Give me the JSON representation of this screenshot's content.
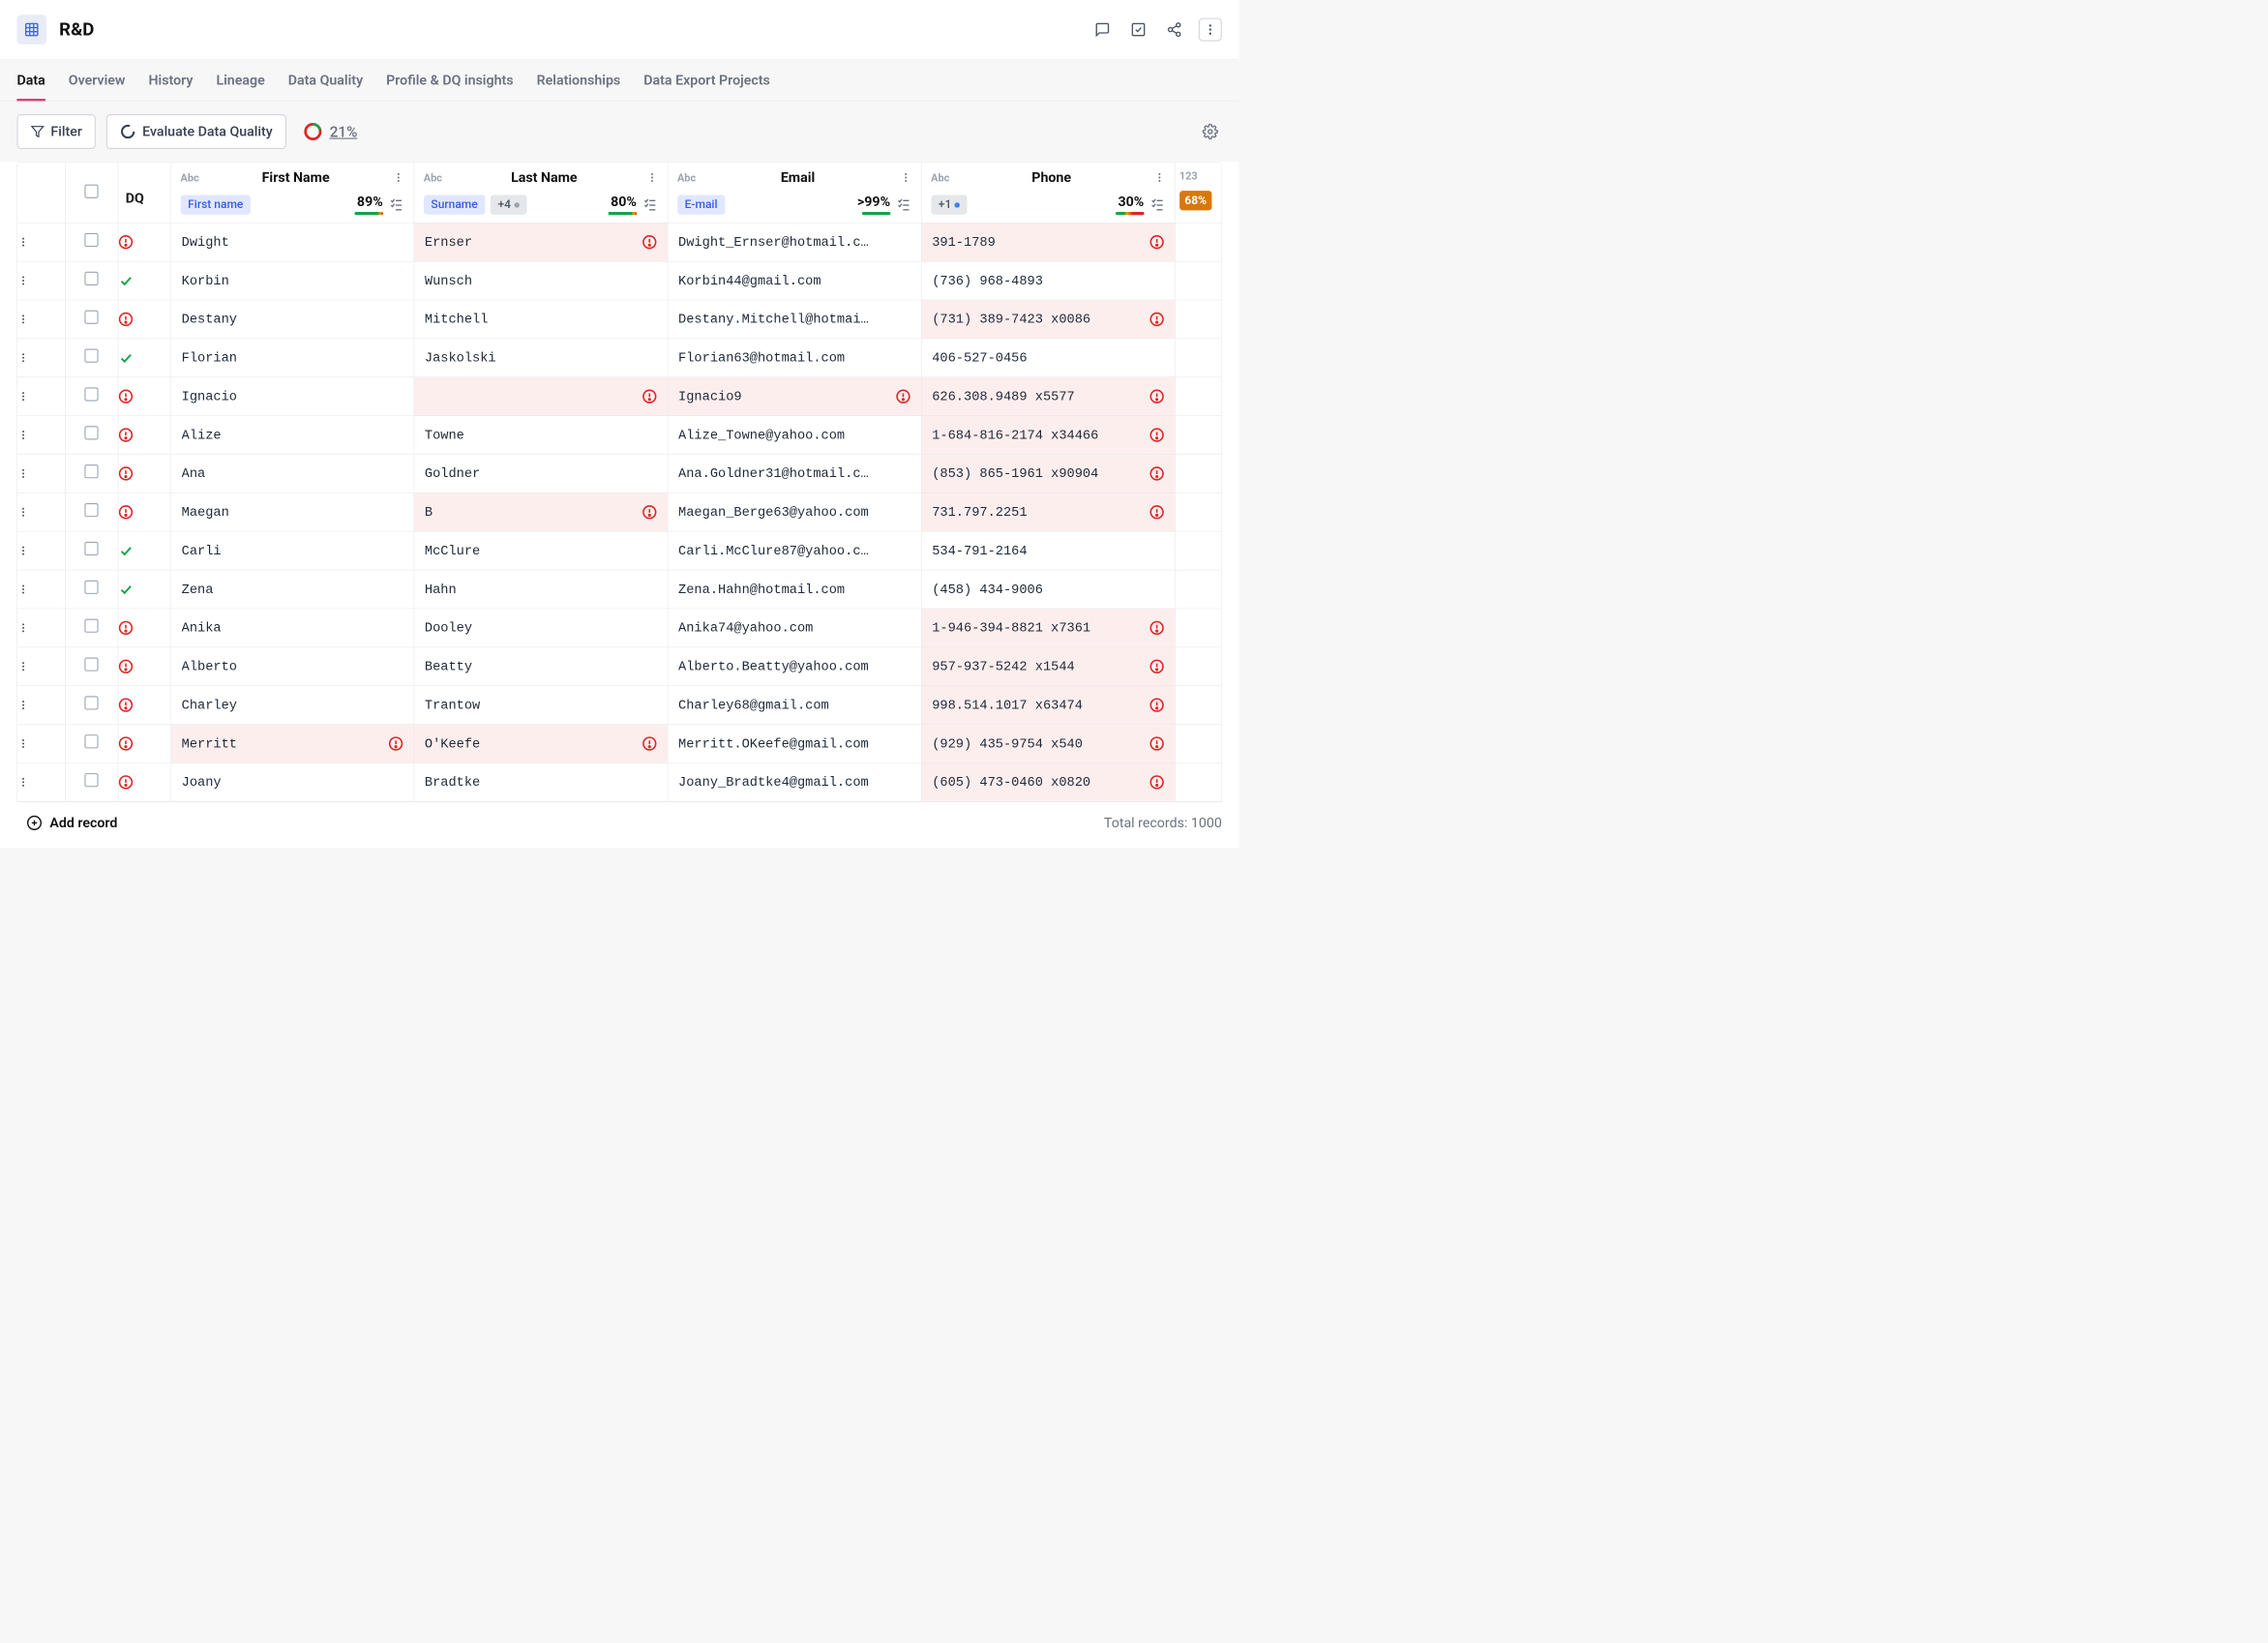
{
  "header": {
    "title": "R&D"
  },
  "tabs": [
    "Data",
    "Overview",
    "History",
    "Lineage",
    "Data Quality",
    "Profile & DQ insights",
    "Relationships",
    "Data Export Projects"
  ],
  "activeTab": 0,
  "toolbar": {
    "filter": "Filter",
    "evaluate": "Evaluate Data Quality",
    "overall_pct": "21%"
  },
  "columns": {
    "dq_label": "DQ",
    "first_name": {
      "type": "Abc",
      "label": "First Name",
      "chip": "First name",
      "pct": "89%"
    },
    "last_name": {
      "type": "Abc",
      "label": "Last Name",
      "chip": "Surname",
      "plus": "+4",
      "pct": "80%"
    },
    "email": {
      "type": "Abc",
      "label": "Email",
      "chip": "E-mail",
      "pct": ">99%"
    },
    "phone": {
      "type": "Abc",
      "label": "Phone",
      "plus": "+1",
      "pct": "30%"
    },
    "extra": {
      "type": "123",
      "badge": "68%"
    }
  },
  "rows": [
    {
      "dq": "fail",
      "first": "Dwight",
      "first_err": false,
      "last": "Ernser",
      "last_err": true,
      "email": "Dwight_Ernser@hotmail.c…",
      "email_err": false,
      "phone": "391-1789",
      "phone_err": true
    },
    {
      "dq": "pass",
      "first": "Korbin",
      "first_err": false,
      "last": "Wunsch",
      "last_err": false,
      "email": "Korbin44@gmail.com",
      "email_err": false,
      "phone": "(736) 968-4893",
      "phone_err": false
    },
    {
      "dq": "fail",
      "first": "Destany",
      "first_err": false,
      "last": "Mitchell",
      "last_err": false,
      "email": "Destany.Mitchell@hotmai…",
      "email_err": false,
      "phone": "(731) 389-7423 x0086",
      "phone_err": true
    },
    {
      "dq": "pass",
      "first": "Florian",
      "first_err": false,
      "last": "Jaskolski",
      "last_err": false,
      "email": "Florian63@hotmail.com",
      "email_err": false,
      "phone": "406-527-0456",
      "phone_err": false
    },
    {
      "dq": "fail",
      "first": "Ignacio",
      "first_err": false,
      "last": "",
      "last_err": true,
      "email": "Ignacio9",
      "email_err": true,
      "phone": "626.308.9489 x5577",
      "phone_err": true
    },
    {
      "dq": "fail",
      "first": "Alize",
      "first_err": false,
      "last": "Towne",
      "last_err": false,
      "email": "Alize_Towne@yahoo.com",
      "email_err": false,
      "phone": "1-684-816-2174 x34466",
      "phone_err": true
    },
    {
      "dq": "fail",
      "first": "Ana",
      "first_err": false,
      "last": "Goldner",
      "last_err": false,
      "email": "Ana.Goldner31@hotmail.c…",
      "email_err": false,
      "phone": "(853) 865-1961 x90904",
      "phone_err": true
    },
    {
      "dq": "fail",
      "first": "Maegan",
      "first_err": false,
      "last": "B",
      "last_err": true,
      "email": "Maegan_Berge63@yahoo.com",
      "email_err": false,
      "phone": "731.797.2251",
      "phone_err": true
    },
    {
      "dq": "pass",
      "first": "Carli",
      "first_err": false,
      "last": "McClure",
      "last_err": false,
      "email": "Carli.McClure87@yahoo.c…",
      "email_err": false,
      "phone": "534-791-2164",
      "phone_err": false
    },
    {
      "dq": "pass",
      "first": "Zena",
      "first_err": false,
      "last": "Hahn",
      "last_err": false,
      "email": "Zena.Hahn@hotmail.com",
      "email_err": false,
      "phone": "(458) 434-9006",
      "phone_err": false
    },
    {
      "dq": "fail",
      "first": "Anika",
      "first_err": false,
      "last": "Dooley",
      "last_err": false,
      "email": "Anika74@yahoo.com",
      "email_err": false,
      "phone": "1-946-394-8821 x7361",
      "phone_err": true
    },
    {
      "dq": "fail",
      "first": "Alberto",
      "first_err": false,
      "last": "Beatty",
      "last_err": false,
      "email": "Alberto.Beatty@yahoo.com",
      "email_err": false,
      "phone": "957-937-5242 x1544",
      "phone_err": true
    },
    {
      "dq": "fail",
      "first": "Charley",
      "first_err": false,
      "last": "Trantow",
      "last_err": false,
      "email": "Charley68@gmail.com",
      "email_err": false,
      "phone": "998.514.1017 x63474",
      "phone_err": true
    },
    {
      "dq": "fail",
      "first": "Merritt",
      "first_err": true,
      "last": "O'Keefe",
      "last_err": true,
      "email": "Merritt.OKeefe@gmail.com",
      "email_err": false,
      "phone": "(929) 435-9754 x540",
      "phone_err": true
    },
    {
      "dq": "fail",
      "first": "Joany",
      "first_err": false,
      "last": "Bradtke",
      "last_err": false,
      "email": "Joany_Bradtke4@gmail.com",
      "email_err": false,
      "phone": "(605) 473-0460 x0820",
      "phone_err": true
    }
  ],
  "footer": {
    "add": "Add record",
    "total_label": "Total records: 1000"
  }
}
